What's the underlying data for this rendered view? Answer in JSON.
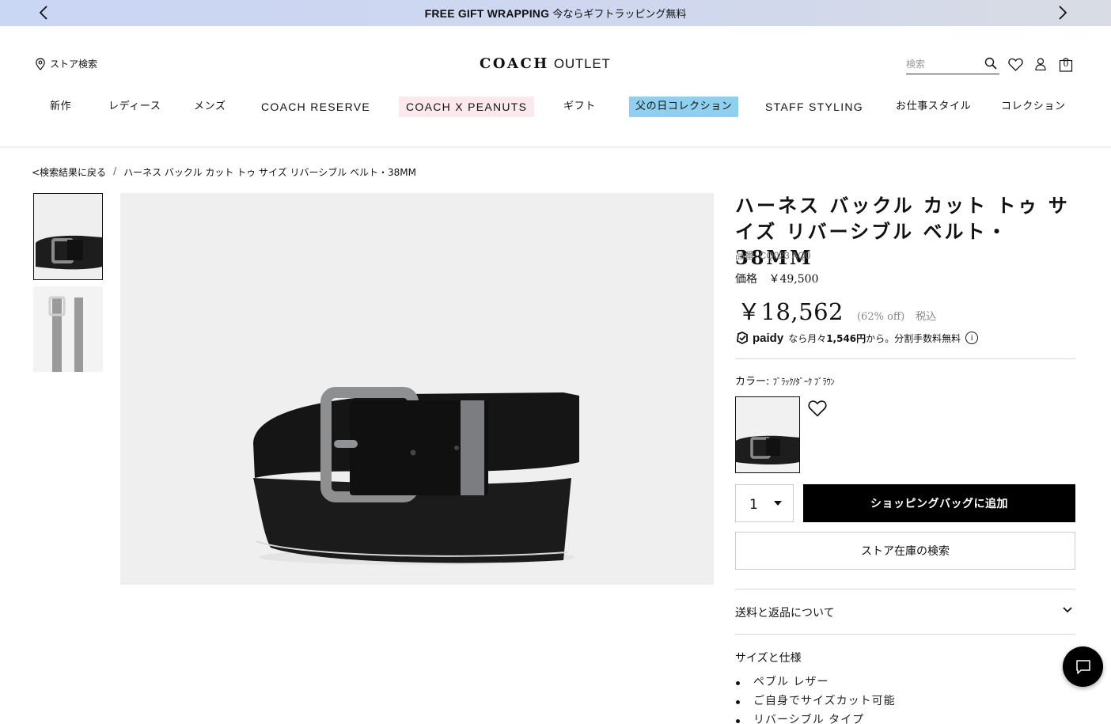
{
  "promo": {
    "headline": "FREE GIFT WRAPPING",
    "subtext": "今ならギフトラッピング無料"
  },
  "header": {
    "store_finder_label": "ストア検索",
    "logo_main": "COACH",
    "logo_sub": "OUTLET",
    "search_placeholder": "検索",
    "bag_count": "0"
  },
  "nav": {
    "items": [
      {
        "label": "新作"
      },
      {
        "label": "レディース"
      },
      {
        "label": "メンズ"
      },
      {
        "label": "COACH RESERVE"
      },
      {
        "label": "COACH X PEANUTS"
      },
      {
        "label": "ギフト"
      },
      {
        "label": "父の日コレクション"
      },
      {
        "label": "STAFF STYLING"
      },
      {
        "label": "お仕事スタイル"
      },
      {
        "label": "コレクション"
      }
    ],
    "highlight_colors": {
      "peanuts_bg": "#fbe9ee",
      "fathers_day_bg": "#8fd0ef"
    }
  },
  "breadcrumb": {
    "back_label": "<検索結果に戻る",
    "separator": "/",
    "current": "ハーネス バックル カット トゥ サイズ リバーシブル ベルト・38MM"
  },
  "product": {
    "title": "ハーネス バックル カット トゥ サイズ リバーシブル ベルト・38MM",
    "sku": "品番: CQ023 AQ0",
    "list_price_label": "価格",
    "list_price": "￥49,500",
    "sale_price": "￥18,562",
    "discount": "(62% off)",
    "tax_note": "税込",
    "paidy_brand": "paidy",
    "paidy_text_prefix": "なら月々",
    "paidy_amount": "1,546円",
    "paidy_text_suffix": "から。分割手数料無料",
    "info_icon_glyph": "i",
    "color_label": "カラー:",
    "color_value": "ﾌﾞﾗｯｸ/ﾀﾞｰｸ ﾌﾞﾗｳﾝ",
    "quantity": "1",
    "add_to_bag": "ショッピングバッグに追加",
    "store_stock": "ストア在庫の検索",
    "shipping_returns": "送料と返品について",
    "size_specs": "サイズと仕様",
    "specs": [
      "ペブル レザー",
      "ご自身でサイズカット可能",
      "リバーシブル タイプ"
    ]
  },
  "icons": {
    "prev": "chevron-left-icon",
    "next": "chevron-right-icon",
    "location": "location-pin-icon",
    "search": "search-icon",
    "wishlist": "heart-icon",
    "account": "user-icon",
    "bag": "shopping-bag-icon",
    "chat": "chat-icon"
  },
  "colors": {
    "promo_bg": "#c9d6f4",
    "primary_button": "#000000",
    "muted_text": "#888888"
  }
}
